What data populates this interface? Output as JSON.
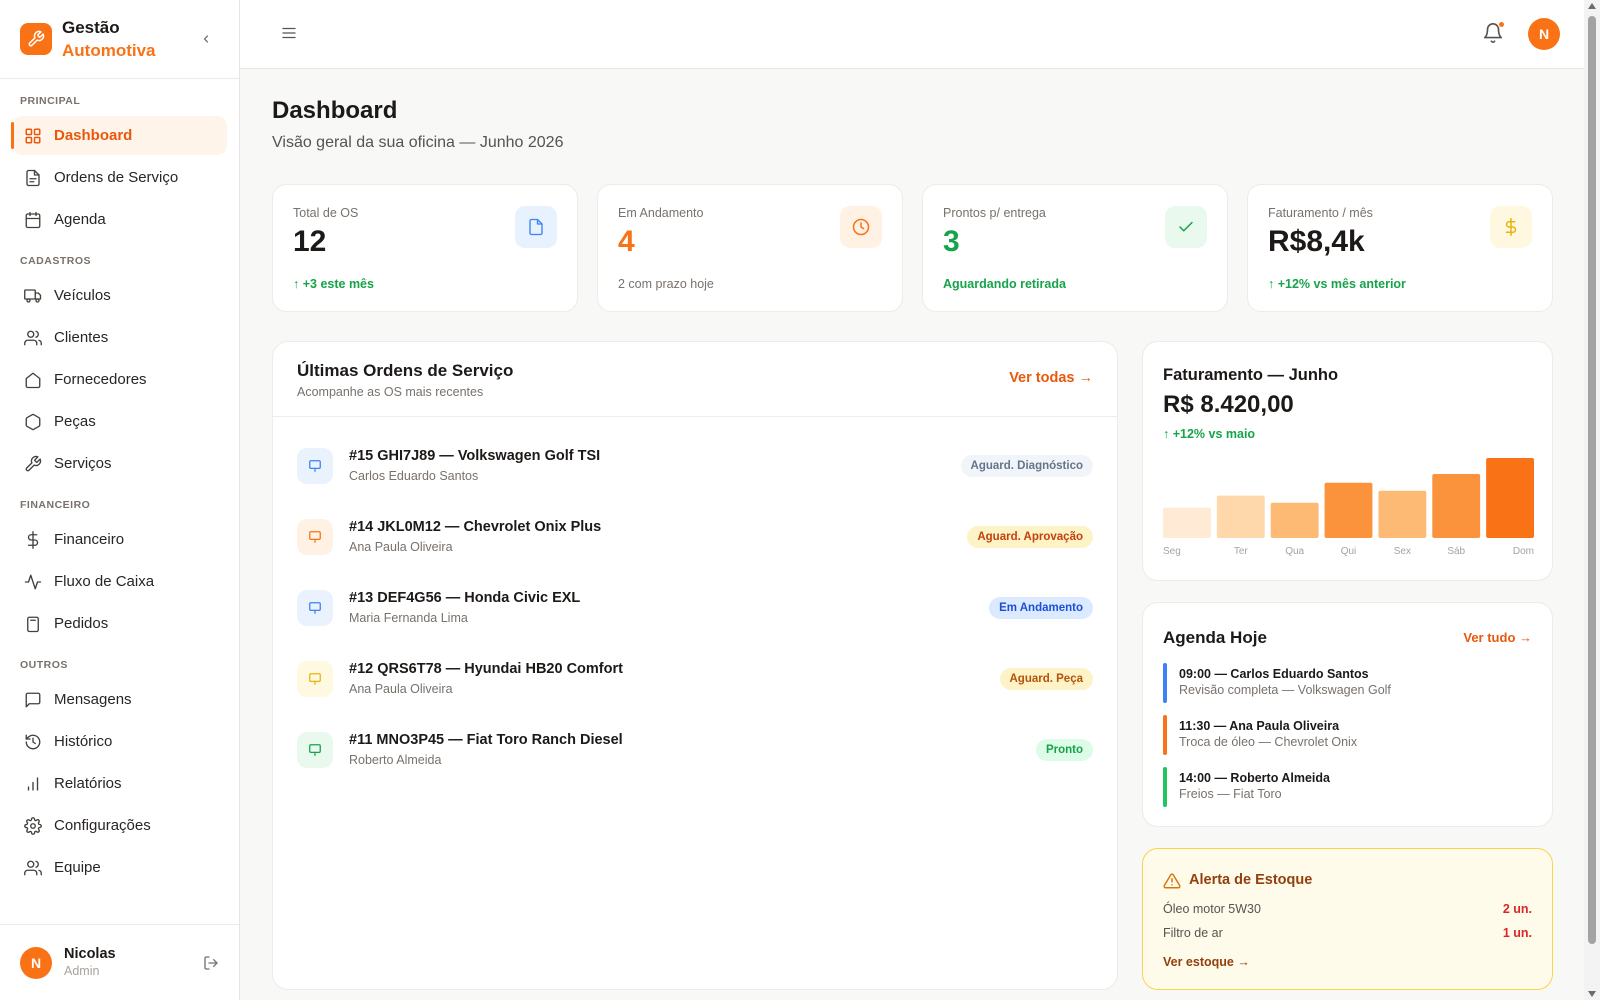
{
  "colors": {
    "accent": "#f97316",
    "success": "#16a34a",
    "info": "#3b82f6",
    "warning": "#eab308",
    "danger": "#dc2626"
  },
  "brand": {
    "line1": "Gestão",
    "line2": "Automotiva"
  },
  "sidebar": {
    "sections": [
      {
        "title": "PRINCIPAL",
        "items": [
          {
            "label": "Dashboard",
            "icon": "grid-icon",
            "active": true
          },
          {
            "label": "Ordens de Serviço",
            "icon": "file-icon"
          },
          {
            "label": "Agenda",
            "icon": "calendar-icon"
          }
        ]
      },
      {
        "title": "CADASTROS",
        "items": [
          {
            "label": "Veículos",
            "icon": "truck-icon"
          },
          {
            "label": "Clientes",
            "icon": "users-icon"
          },
          {
            "label": "Fornecedores",
            "icon": "home-icon"
          },
          {
            "label": "Peças",
            "icon": "hexagon-icon"
          },
          {
            "label": "Serviços",
            "icon": "wrench-icon"
          }
        ]
      },
      {
        "title": "FINANCEIRO",
        "items": [
          {
            "label": "Financeiro",
            "icon": "dollar-icon"
          },
          {
            "label": "Fluxo de Caixa",
            "icon": "activity-icon"
          },
          {
            "label": "Pedidos",
            "icon": "clipboard-icon"
          }
        ]
      },
      {
        "title": "OUTROS",
        "items": [
          {
            "label": "Mensagens",
            "icon": "message-icon"
          },
          {
            "label": "Histórico",
            "icon": "history-icon"
          },
          {
            "label": "Relatórios",
            "icon": "bar-chart-icon"
          },
          {
            "label": "Configurações",
            "icon": "gear-icon"
          },
          {
            "label": "Equipe",
            "icon": "users-icon"
          }
        ]
      }
    ]
  },
  "user": {
    "initial": "N",
    "name": "Nicolas",
    "role": "Admin"
  },
  "header": {
    "avatar_initial": "N"
  },
  "page": {
    "title": "Dashboard",
    "subtitle": "Visão geral da sua oficina — Junho 2026"
  },
  "stats": [
    {
      "label": "Total de OS",
      "value": "12",
      "note": "↑ +3 este mês",
      "icon": "file-icon"
    },
    {
      "label": "Em Andamento",
      "value": "4",
      "note": "2 com prazo hoje",
      "icon": "clock-icon"
    },
    {
      "label": "Prontos p/ entrega",
      "value": "3",
      "note": "Aguardando retirada",
      "icon": "check-icon"
    },
    {
      "label": "Faturamento / mês",
      "value": "R$8,4k",
      "note": "↑ +12% vs mês anterior",
      "icon": "dollar-icon"
    }
  ],
  "orders": {
    "title": "Últimas Ordens de Serviço",
    "subtitle": "Acompanhe as OS mais recentes",
    "view_all": "Ver todas →",
    "rows": [
      {
        "title": "#15 GHI7J89 — Volkswagen Golf TSI",
        "client": "Carlos Eduardo Santos",
        "status": "Aguard. Diagnóstico",
        "icon_color": "#3b82f6"
      },
      {
        "title": "#14 JKL0M12 — Chevrolet Onix Plus",
        "client": "Ana Paula Oliveira",
        "status": "Aguard. Aprovação",
        "icon_color": "#f97316"
      },
      {
        "title": "#13 DEF4G56 — Honda Civic EXL",
        "client": "Maria Fernanda Lima",
        "status": "Em Andamento",
        "icon_color": "#3b82f6"
      },
      {
        "title": "#12 QRS6T78 — Hyundai HB20 Comfort",
        "client": "Ana Paula Oliveira",
        "status": "Aguard. Peça",
        "icon_color": "#eab308"
      },
      {
        "title": "#11 MNO3P45 — Fiat Toro Ranch Diesel",
        "client": "Roberto Almeida",
        "status": "Pronto",
        "icon_color": "#16a34a"
      }
    ]
  },
  "revenue": {
    "title": "Faturamento — Junho",
    "amount": "R$ 8.420,00",
    "delta": "↑ +12% vs maio",
    "chart_data": {
      "type": "bar",
      "categories": [
        "Seg",
        "Ter",
        "Qua",
        "Qui",
        "Sex",
        "Sáb",
        "Dom"
      ],
      "values": [
        38,
        53,
        44,
        69,
        59,
        80,
        100
      ],
      "ylim": [
        0,
        100
      ],
      "colors": [
        "#ffead5",
        "#fed7aa",
        "#fdba74",
        "#fb923c",
        "#fdba74",
        "#fb923c",
        "#f97316"
      ]
    }
  },
  "agenda": {
    "title": "Agenda Hoje",
    "view_all": "Ver tudo →",
    "items": [
      {
        "time_name": "09:00 — Carlos Eduardo Santos",
        "desc": "Revisão completa — Volkswagen Golf",
        "color": "#3b82f6"
      },
      {
        "time_name": "11:30 — Ana Paula Oliveira",
        "desc": "Troca de óleo — Chevrolet Onix",
        "color": "#f97316"
      },
      {
        "time_name": "14:00 — Roberto Almeida",
        "desc": "Freios — Fiat Toro",
        "color": "#22c55e"
      }
    ]
  },
  "stock_alert": {
    "title": "Alerta de Estoque",
    "items": [
      {
        "name": "Óleo motor 5W30",
        "qty": "2 un."
      },
      {
        "name": "Filtro de ar",
        "qty": "1 un."
      }
    ],
    "link": "Ver estoque →"
  }
}
